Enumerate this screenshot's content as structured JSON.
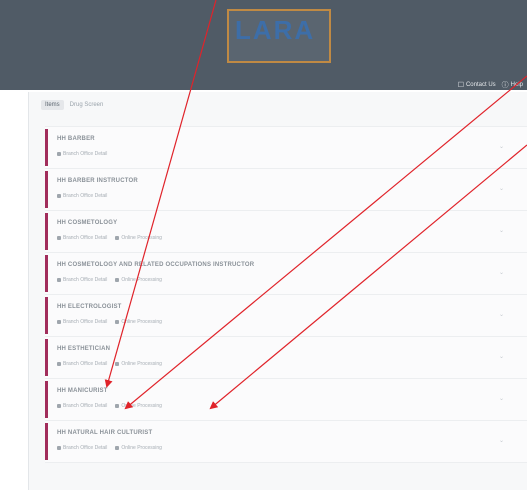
{
  "header": {
    "logo_text": "LARA",
    "actions": [
      {
        "icon": "contact-icon",
        "label": "Contact Us"
      },
      {
        "icon": "help-icon",
        "label": "Help"
      }
    ]
  },
  "tabs": [
    {
      "label": "Items",
      "active": true
    },
    {
      "label": "Drug Screen",
      "active": false
    }
  ],
  "licenses": [
    {
      "title": "HH BARBER",
      "chips": [
        "Branch Office Detail"
      ]
    },
    {
      "title": "HH BARBER INSTRUCTOR",
      "chips": [
        "Branch Office Detail"
      ]
    },
    {
      "title": "HH COSMETOLOGY",
      "chips": [
        "Branch Office Detail",
        "Online Processing"
      ]
    },
    {
      "title": "HH COSMETOLOGY AND RELATED OCCUPATIONS INSTRUCTOR",
      "chips": [
        "Branch Office Detail",
        "Online Processing"
      ]
    },
    {
      "title": "HH ELECTROLOGIST",
      "chips": [
        "Branch Office Detail",
        "Online Processing"
      ]
    },
    {
      "title": "HH ESTHETICIAN",
      "chips": [
        "Branch Office Detail",
        "Online Processing"
      ]
    },
    {
      "title": "HH MANICURIST",
      "chips": [
        "Branch Office Detail",
        "Online Processing"
      ]
    },
    {
      "title": "HH NATURAL HAIR CULTURIST",
      "chips": [
        "Branch Office Detail",
        "Online Processing"
      ]
    }
  ],
  "colors": {
    "header": "#505b66",
    "accent_bar": "#a12d5b",
    "annotation": "#e0232a"
  }
}
